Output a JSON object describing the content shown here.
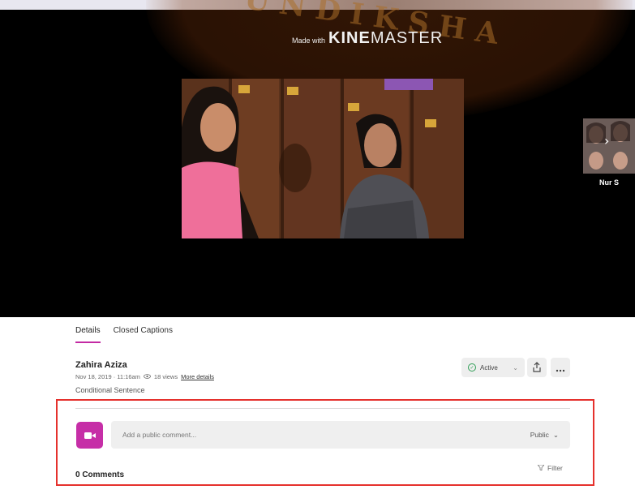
{
  "video": {
    "watermark_small": "Made with",
    "watermark_brand_bold": "KINE",
    "watermark_brand_light": "MASTER",
    "watermark_letters": "UNDIKSHA",
    "next_thumb_name": "Nur S"
  },
  "tabs": [
    {
      "label": "Details",
      "active": true
    },
    {
      "label": "Closed Captions",
      "active": false
    }
  ],
  "details": {
    "author": "Zahira Aziza",
    "date": "Nov 18, 2019 · 11:16am",
    "views": "18 views",
    "more_details": "More details",
    "description": "Conditional Sentence"
  },
  "actions": {
    "status_label": "Active",
    "status_color": "#2e9e55",
    "share_icon": "share-icon",
    "more_icon": "more-icon"
  },
  "comments": {
    "placeholder": "Add a public comment...",
    "visibility": "Public",
    "count_label": "0 Comments",
    "filter_label": "Filter",
    "camera_button_color": "#c62ea7"
  },
  "colors": {
    "accent": "#c32aa3",
    "highlight": "#e5312d"
  }
}
